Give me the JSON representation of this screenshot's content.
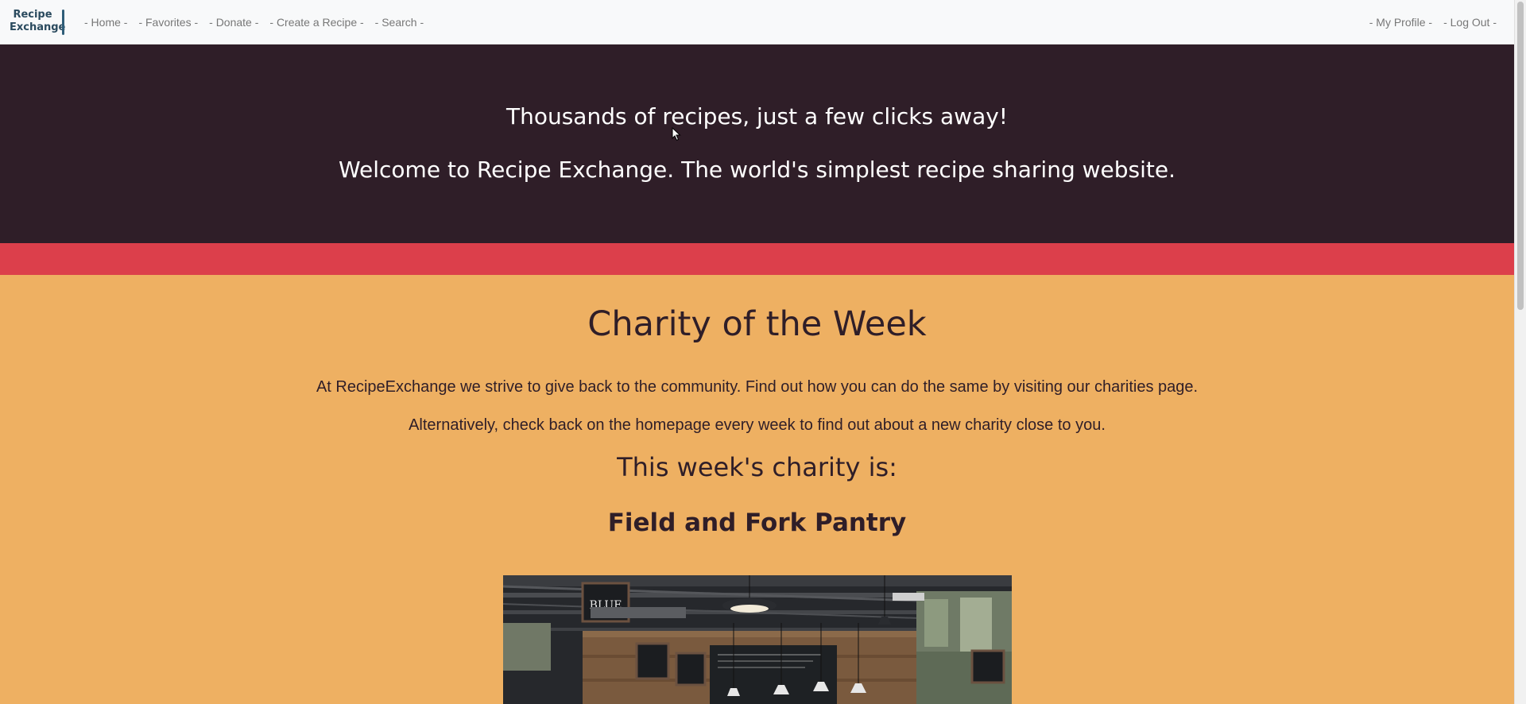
{
  "navbar": {
    "logo": {
      "line1": "Recipe",
      "line2": "Exchange"
    },
    "left_links": [
      "- Home -",
      "- Favorites -",
      "- Donate -",
      "- Create a Recipe -",
      "- Search -"
    ],
    "right_links": [
      "- My Profile -",
      "- Log Out -"
    ]
  },
  "hero": {
    "heading1": "Thousands of recipes, just a few clicks away!",
    "heading2": "Welcome to Recipe Exchange. The world's simplest recipe sharing website."
  },
  "charity": {
    "title": "Charity of the Week",
    "paragraph1": "At RecipeExchange we strive to give back to the community. Find out how you can do the same by visiting our charities page.",
    "paragraph2": "Alternatively, check back on the homepage every week to find out about a new charity close to you.",
    "subheading": "This week's charity is:",
    "name": "Field and Fork Pantry",
    "photo_sign_text": "BLUE"
  },
  "colors": {
    "navbar_bg": "#f8f9fa",
    "hero_bg": "#2f1e28",
    "accent_bar": "#dc3f4b",
    "section_bg": "#eeb062",
    "text_dark": "#2f1e28"
  }
}
